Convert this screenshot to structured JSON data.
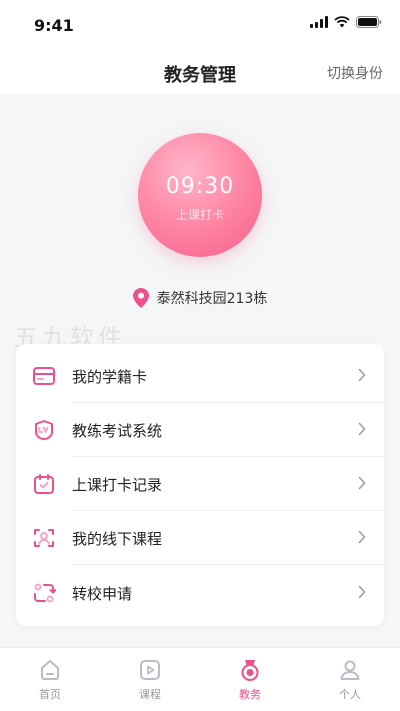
{
  "status_bar": {
    "time": "9:41"
  },
  "header": {
    "title": "教务管理",
    "switch_identity": "切换身份"
  },
  "clock_in": {
    "time": "09:30",
    "label": "上课打卡"
  },
  "location": {
    "text": "泰然科技园213栋",
    "icon": "location-pin-icon"
  },
  "watermark": {
    "text": "五九软件"
  },
  "menu": {
    "items": [
      {
        "label": "我的学籍卡",
        "icon": "student-card-icon"
      },
      {
        "label": "教练考试系统",
        "icon": "exam-lv-icon"
      },
      {
        "label": "上课打卡记录",
        "icon": "calendar-check-icon"
      },
      {
        "label": "我的线下课程",
        "icon": "face-scan-icon"
      },
      {
        "label": "转校申请",
        "icon": "transfer-icon"
      }
    ]
  },
  "bottom_nav": {
    "items": [
      {
        "label": "首页",
        "icon": "home-icon",
        "active": false
      },
      {
        "label": "课程",
        "icon": "play-icon",
        "active": false
      },
      {
        "label": "教务",
        "icon": "medal-icon",
        "active": true
      },
      {
        "label": "个人",
        "icon": "person-icon",
        "active": false
      }
    ]
  },
  "colors": {
    "accent": "#f0508a",
    "inactive": "#999999",
    "background": "#f4f6f8"
  }
}
